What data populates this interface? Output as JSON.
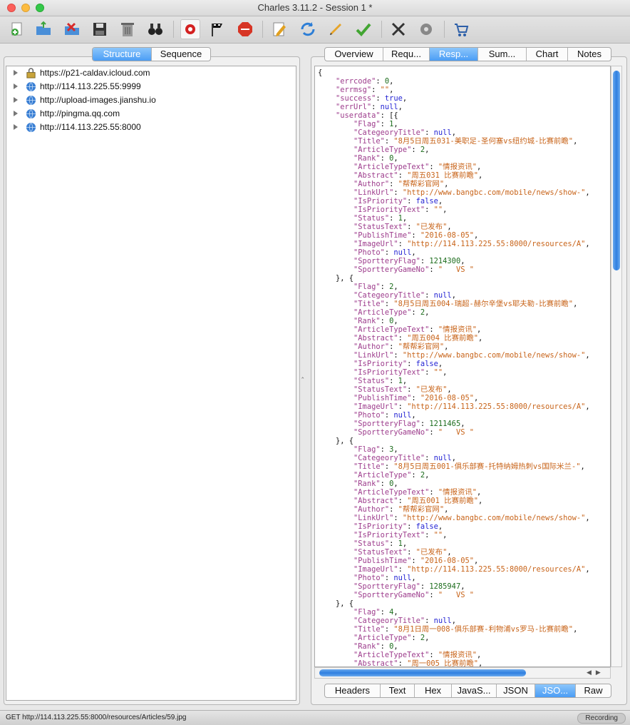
{
  "window": {
    "title": "Charles 3.11.2 - Session 1 *"
  },
  "toolbar": {
    "icons": [
      "new-session-icon",
      "open-session-icon",
      "close-session-icon",
      "save-session-icon",
      "clear-session-icon",
      "find-icon",
      "record-icon",
      "throttle-icon",
      "breakpoints-icon",
      "edit-icon",
      "repeat-icon",
      "compose-icon",
      "validate-icon",
      "tools-icon",
      "settings-icon",
      "help-icon"
    ]
  },
  "left_tabs": {
    "structure": "Structure",
    "sequence": "Sequence",
    "selected": "Structure"
  },
  "tree": {
    "items": [
      {
        "label": "https://p21-caldav.icloud.com",
        "icon": "lock-icon"
      },
      {
        "label": "http://114.113.225.55:9999",
        "icon": "globe-icon"
      },
      {
        "label": "http://upload-images.jianshu.io",
        "icon": "globe-icon"
      },
      {
        "label": "http://pingma.qq.com",
        "icon": "globe-icon"
      },
      {
        "label": "http://114.113.225.55:8000",
        "icon": "globe-icon"
      }
    ]
  },
  "right_tabs": {
    "items": [
      "Overview",
      "Requ...",
      "Resp...",
      "Sum...",
      "Chart",
      "Notes"
    ],
    "selected": "Resp..."
  },
  "bottom_tabs": {
    "items": [
      "Headers",
      "Text",
      "Hex",
      "JavaS...",
      "JSON",
      "JSO...",
      "Raw"
    ],
    "selected": "JSO..."
  },
  "response": {
    "errcode": 0,
    "errmsg": "",
    "success": true,
    "errUrl": null,
    "items": [
      {
        "Flag": 1,
        "CategeoryTitle": null,
        "Title": "8月5日周五031-美职足-圣何塞vs纽约城-比赛前瞻",
        "ArticleType": 2,
        "Rank": 0,
        "ArticleTypeText": "情报资讯",
        "Abstract": "周五031 比赛前瞻",
        "Author": "帮帮彩官网",
        "LinkUrl": "http://www.bangbc.com/mobile/news/show-",
        "IsPriority": false,
        "IsPriorityText": "",
        "Status": 1,
        "StatusText": "已发布",
        "PublishTime": "2016-08-05",
        "ImageUrl": "http://114.113.225.55:8000/resources/A",
        "Photo": null,
        "SportteryFlag": 1214300,
        "SportteryGameNo": "   VS "
      },
      {
        "Flag": 2,
        "CategeoryTitle": null,
        "Title": "8月5日周五004-瑞超-赫尔辛堡vs耶夫勒-比赛前瞻",
        "ArticleType": 2,
        "Rank": 0,
        "ArticleTypeText": "情报资讯",
        "Abstract": "周五004 比赛前瞻",
        "Author": "帮帮彩官网",
        "LinkUrl": "http://www.bangbc.com/mobile/news/show-",
        "IsPriority": false,
        "IsPriorityText": "",
        "Status": 1,
        "StatusText": "已发布",
        "PublishTime": "2016-08-05",
        "ImageUrl": "http://114.113.225.55:8000/resources/A",
        "Photo": null,
        "SportteryFlag": 1211465,
        "SportteryGameNo": "   VS "
      },
      {
        "Flag": 3,
        "CategeoryTitle": null,
        "Title": "8月5日周五001-俱乐部赛-托特纳姆热刺vs国际米兰-",
        "ArticleType": 2,
        "Rank": 0,
        "ArticleTypeText": "情报资讯",
        "Abstract": "周五001 比赛前瞻",
        "Author": "帮帮彩官网",
        "LinkUrl": "http://www.bangbc.com/mobile/news/show-",
        "IsPriority": false,
        "IsPriorityText": "",
        "Status": 1,
        "StatusText": "已发布",
        "PublishTime": "2016-08-05",
        "ImageUrl": "http://114.113.225.55:8000/resources/A",
        "Photo": null,
        "SportteryFlag": 1285947,
        "SportteryGameNo": "   VS "
      },
      {
        "Flag": 4,
        "CategeoryTitle": null,
        "Title": "8月1日周一008-俱乐部赛-利物浦vs罗马-比赛前瞻",
        "ArticleType": 2,
        "Rank": 0,
        "ArticleTypeText": "情报资讯",
        "Abstract": "周一005 比赛前瞻",
        "Author": "帮帮彩官网"
      }
    ]
  },
  "status": {
    "url": "GET http://114.113.225.55:8000/resources/Articles/59.jpg",
    "recording": "Recording"
  }
}
